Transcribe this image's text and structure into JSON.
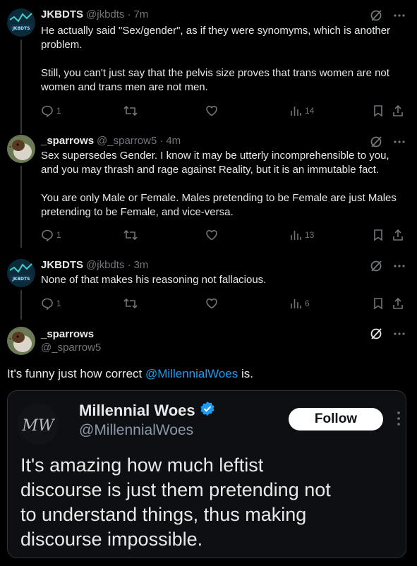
{
  "replies": [
    {
      "name": "JKBDTS",
      "handle": "@jkbdts",
      "time": "7m",
      "text": "He actually said \"Sex/gender\", as if they were synomyms, which is another problem.\n\nStill, you can't just say that the pelvis size proves that trans women are not women and trans men are not men.",
      "reply_count": "1",
      "views": "14",
      "avatar_text": "JKBDTS"
    },
    {
      "name": "_sparrows",
      "handle": "@_sparrow5",
      "time": "4m",
      "text": "Sex supersedes Gender. I know it may be utterly incomprehensible to you, and you may thrash and rage against Reality, but it is an immutable fact.\n\nYou are only Male or Female. Males pretending to be Female are just Males pretending to be Female, and vice-versa.",
      "reply_count": "1",
      "views": "13"
    },
    {
      "name": "JKBDTS",
      "handle": "@jkbdts",
      "time": "3m",
      "text": "None of that makes his reasoning not fallacious.",
      "reply_count": "1",
      "views": "6",
      "avatar_text": "JKBDTS"
    }
  ],
  "sep": "·",
  "main": {
    "name": "_sparrows",
    "handle": "@_sparrow5",
    "text_before": "It's funny just how correct ",
    "mention": "@MillennialWoes",
    "text_after": " is."
  },
  "card": {
    "name": "Millennial Woes",
    "handle": "@MillennialWoes",
    "follow_label": "Follow",
    "logo_text": "MW",
    "text": "It's amazing how much leftist\ndiscourse is just them pretending not\nto understand things, thus making\ndiscourse impossible."
  },
  "colors": {
    "background": "#000000",
    "text": "#e7e9ea",
    "muted": "#71767b",
    "link": "#1d9bf0",
    "verified": "#1d9bf0"
  },
  "icons": [
    "grok-icon",
    "more-icon",
    "reply-icon",
    "retweet-icon",
    "like-icon",
    "views-icon",
    "bookmark-icon",
    "share-icon",
    "verified-icon"
  ]
}
